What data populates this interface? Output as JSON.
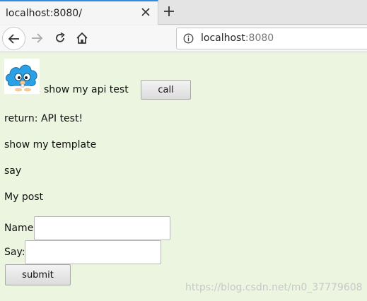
{
  "browser": {
    "tab_title": "localhost:8080/",
    "url_host": "localhost",
    "url_port": ":8080"
  },
  "page": {
    "api_label": "show my api test",
    "call_button": "call",
    "return_text": "return: API test!",
    "template_text": "show my template",
    "say_text": "say",
    "post_text": "My post",
    "name_label": "Name:",
    "name_value": "",
    "say_label": "Say:",
    "say_value": "",
    "submit_button": "submit",
    "watermark": "https://blog.csdn.net/m0_37779608"
  },
  "colors": {
    "page_background": "#ecf5df",
    "tab_accent": "#2f8dde",
    "logo_blue": "#2aa1e6"
  }
}
